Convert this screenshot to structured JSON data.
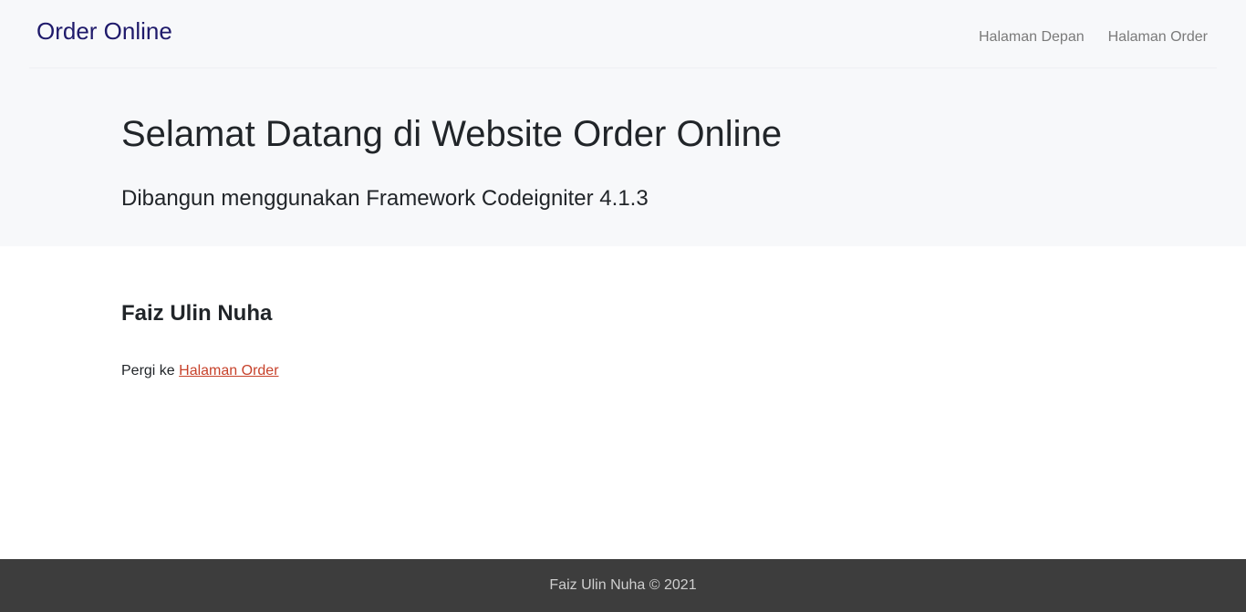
{
  "navbar": {
    "brand": "Order Online",
    "links": [
      "Halaman Depan",
      "Halaman Order"
    ]
  },
  "hero": {
    "title": "Selamat Datang di Website Order Online",
    "subtitle": "Dibangun menggunakan Framework Codeigniter 4.1.3"
  },
  "content": {
    "author": "Faiz Ulin Nuha",
    "goto_prefix": "Pergi ke ",
    "goto_link": "Halaman Order"
  },
  "footer": {
    "text": "Faiz Ulin Nuha © 2021"
  },
  "colors": {
    "brand": "#1f1a6b",
    "link": "#c7422b",
    "footer_bg": "#3d3d3d",
    "top_band_bg": "#f7f8fa"
  }
}
